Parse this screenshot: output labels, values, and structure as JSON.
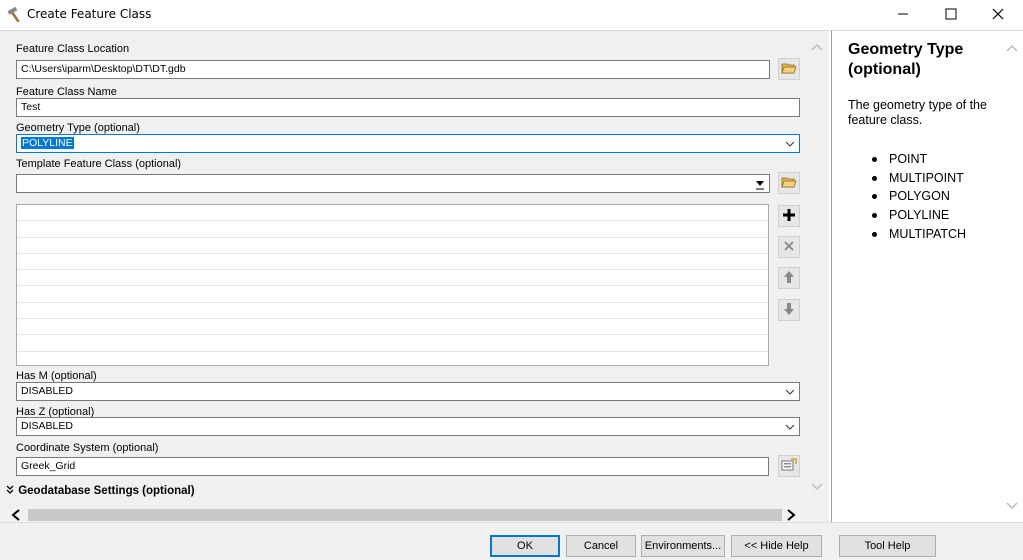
{
  "window": {
    "title": "Create Feature Class",
    "icons": {
      "app": "hammer-icon",
      "minimize": "minimize-icon",
      "maximize": "maximize-icon",
      "close": "close-icon"
    }
  },
  "form": {
    "location": {
      "label": "Feature Class Location",
      "value": "C:\\Users\\iparm\\Desktop\\DT\\DT.gdb",
      "browse_icon": "folder-open-icon"
    },
    "name": {
      "label": "Feature Class Name",
      "value": "Test"
    },
    "geometry": {
      "label": "Geometry Type (optional)",
      "value": "POLYLINE",
      "selected": true
    },
    "template": {
      "label": "Template Feature Class (optional)",
      "value": "",
      "browse_icon": "folder-open-icon"
    },
    "template_list": {
      "rows": 10,
      "add_icon": "plus-icon",
      "remove_icon": "x-icon",
      "up_icon": "arrow-up-icon",
      "down_icon": "arrow-down-icon"
    },
    "has_m": {
      "label": "Has M (optional)",
      "value": "DISABLED"
    },
    "has_z": {
      "label": "Has Z (optional)",
      "value": "DISABLED"
    },
    "coord": {
      "label": "Coordinate System (optional)",
      "value": "Greek_Grid",
      "props_icon": "spatial-reference-icon"
    },
    "geodatabase_settings": {
      "label": "Geodatabase Settings (optional)",
      "expander_icon": "double-chevron-down-icon"
    }
  },
  "help": {
    "title": "Geometry Type (optional)",
    "description": "The geometry type of the feature class.",
    "items": [
      "POINT",
      "MULTIPOINT",
      "POLYGON",
      "POLYLINE",
      "MULTIPATCH"
    ]
  },
  "buttons": {
    "ok": "OK",
    "cancel": "Cancel",
    "environments": "Environments...",
    "hide_help": "<< Hide Help",
    "tool_help": "Tool Help"
  },
  "colors": {
    "selection": "#0078d7",
    "panel": "#f0f0f0",
    "border": "#7a7a7a"
  }
}
